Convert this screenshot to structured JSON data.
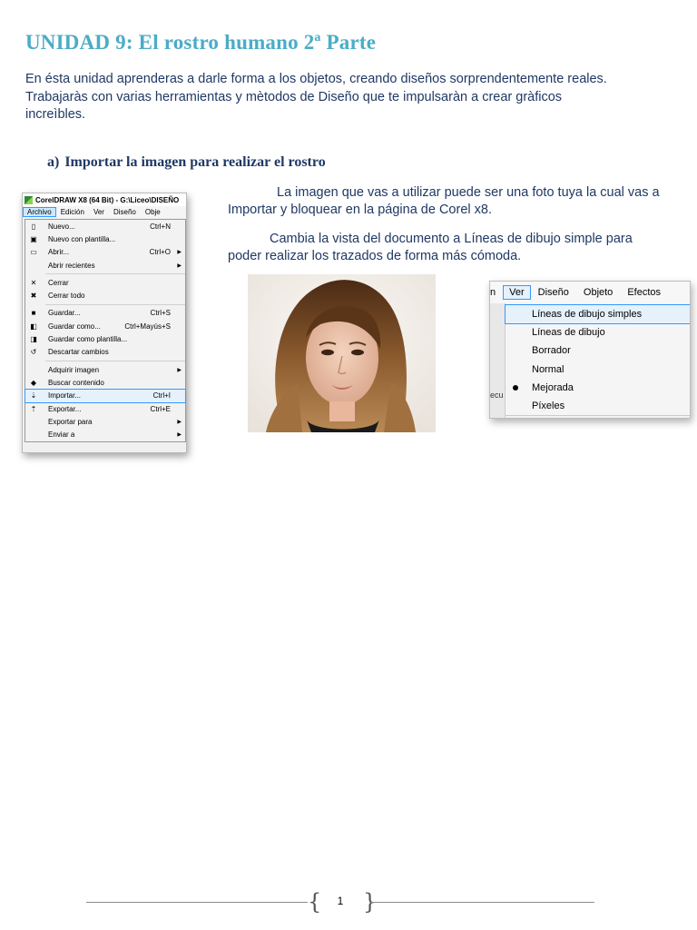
{
  "title": "UNIDAD 9: El rostro humano 2ª Parte",
  "intro": {
    "line1": "En ésta unidad aprenderas a darle forma a los objetos, creando diseños sorprendentemente reales.",
    "line2": "Trabajaràs con varias herramientas y mètodos de Diseño que te impulsaràn a crear gràficos",
    "line3": "increìbles."
  },
  "section": {
    "letter": "a)",
    "heading": "Importar la imagen para realizar el rostro"
  },
  "paragraphs": {
    "p1": "La imagen que vas a utilizar puede ser una foto tuya la cual vas a Importar y bloquear en la página de Corel x8.",
    "p2": "Cambia la vista del documento a Líneas de dibujo simple para poder realizar los trazados de forma más cómoda."
  },
  "corel": {
    "window_title": "CorelDRAW X8 (64 Bit) - G:\\Liceo\\DISEÑO",
    "menubar": [
      "Archivo",
      "Edición",
      "Ver",
      "Diseño",
      "Obje"
    ],
    "items": [
      {
        "icon": "new-icon",
        "label": "Nuevo...",
        "shortcut": "Ctrl+N"
      },
      {
        "icon": "new-from-template-icon",
        "label": "Nuevo con plantilla...",
        "shortcut": ""
      },
      {
        "icon": "open-folder-icon",
        "label": "Abrir...",
        "shortcut": "Ctrl+O",
        "arrow": true
      },
      {
        "icon": "",
        "label": "Abrir recientes",
        "shortcut": "",
        "arrow": true
      },
      {
        "sep": true
      },
      {
        "icon": "close-icon",
        "label": "Cerrar",
        "shortcut": ""
      },
      {
        "icon": "close-all-icon",
        "label": "Cerrar todo",
        "shortcut": ""
      },
      {
        "sep": true
      },
      {
        "icon": "save-icon",
        "label": "Guardar...",
        "shortcut": "Ctrl+S"
      },
      {
        "icon": "save-as-icon",
        "label": "Guardar como...",
        "shortcut": "Ctrl+Mayús+S"
      },
      {
        "icon": "save-template-icon",
        "label": "Guardar como plantilla...",
        "shortcut": ""
      },
      {
        "icon": "revert-icon",
        "label": "Descartar cambios",
        "shortcut": ""
      },
      {
        "sep": true
      },
      {
        "icon": "",
        "label": "Adquirir imagen",
        "shortcut": "",
        "arrow": true
      },
      {
        "icon": "search-content-icon",
        "label": "Buscar contenido",
        "shortcut": ""
      },
      {
        "icon": "import-icon",
        "label": "Importar...",
        "shortcut": "Ctrl+I",
        "highlight": true
      },
      {
        "icon": "export-icon",
        "label": "Exportar...",
        "shortcut": "Ctrl+E"
      },
      {
        "icon": "",
        "label": "Exportar para",
        "shortcut": "",
        "arrow": true
      },
      {
        "icon": "",
        "label": "Enviar a",
        "shortcut": "",
        "arrow": true
      }
    ]
  },
  "vermenu": {
    "fragment": "n",
    "menubar": [
      "Ver",
      "Diseño",
      "Objeto",
      "Efectos"
    ],
    "side_fragment": "ecu",
    "items": [
      {
        "label": "Líneas de dibujo simples",
        "highlight": true
      },
      {
        "label": "Líneas de dibujo"
      },
      {
        "label": "Borrador"
      },
      {
        "label": "Normal"
      },
      {
        "label": "Mejorada",
        "selected": true
      },
      {
        "label": "Píxeles"
      }
    ]
  },
  "footer": {
    "page": "1"
  }
}
